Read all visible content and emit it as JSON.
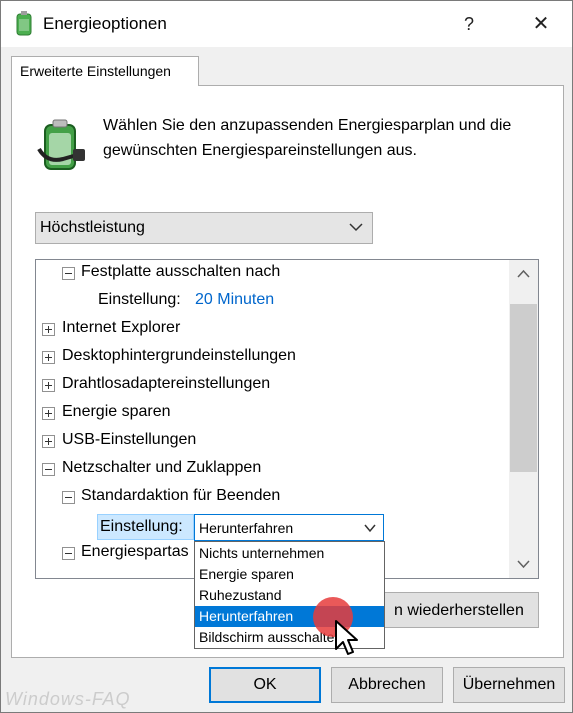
{
  "window": {
    "title": "Energieoptionen",
    "help_glyph": "?",
    "close_glyph": "✕"
  },
  "tab": {
    "label": "Erweiterte Einstellungen"
  },
  "intro": {
    "text": "Wählen Sie den anzupassenden Energiesparplan und die gewünschten Energiespareinstellungen aus."
  },
  "plan": {
    "selected": "Höchstleistung"
  },
  "tree": {
    "rows": [
      {
        "label": "Festplatte ausschalten nach"
      },
      {
        "label": "Einstellung:",
        "value": "20 Minuten"
      },
      {
        "label": "Internet Explorer"
      },
      {
        "label": "Desktophintergrundeinstellungen"
      },
      {
        "label": "Drahtlosadaptereinstellungen"
      },
      {
        "label": "Energie sparen"
      },
      {
        "label": "USB-Einstellungen"
      },
      {
        "label": "Netzschalter und Zuklappen"
      },
      {
        "label": "Standardaktion für Beenden"
      },
      {
        "label": "Einstellung:"
      },
      {
        "label": "Energiespartas"
      }
    ]
  },
  "combo": {
    "selected": "Herunterfahren",
    "options": [
      "Nichts unternehmen",
      "Energie sparen",
      "Ruhezustand",
      "Herunterfahren",
      "Bildschirm ausschalten"
    ]
  },
  "buttons": {
    "restore": "Planstandard wiederherstellen",
    "restore_visible": "n wiederherstellen",
    "ok": "OK",
    "cancel": "Abbrechen",
    "apply": "Übernehmen"
  },
  "watermark": "Windows-FAQ",
  "colors": {
    "accent": "#0078d7",
    "link": "#0066cc",
    "highlight": "#cce8ff",
    "cursor_dot": "#e63c3c"
  }
}
